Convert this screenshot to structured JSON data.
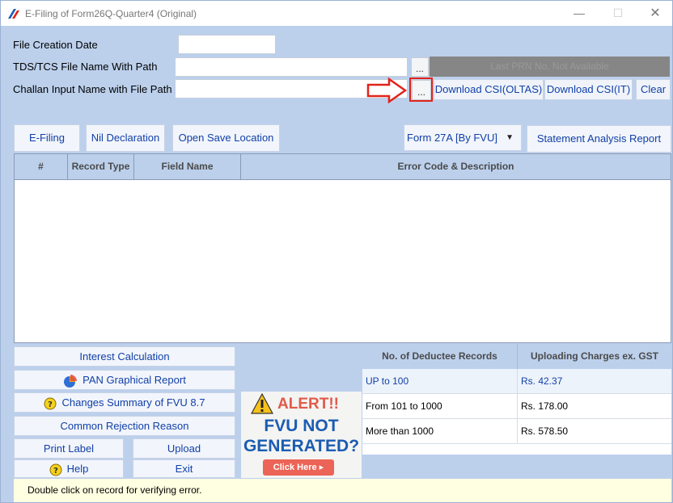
{
  "window": {
    "title": "E-Filing of Form26Q-Quarter4 (Original)",
    "minimize": "—",
    "maximize": "☐",
    "close": "✕"
  },
  "form": {
    "file_creation_date_label": "File Creation Date",
    "file_creation_date_value": "",
    "tds_file_label": "TDS/TCS File Name With Path",
    "tds_file_value": "",
    "tds_browse": "...",
    "prn_status": "Last PRN No. Not Available",
    "challan_label": "Challan Input Name with File Path",
    "challan_value": "",
    "challan_browse": "...",
    "download_oltas": "Download CSI(OLTAS)",
    "download_it": "Download CSI(IT)",
    "clear": "Clear"
  },
  "toolbar": {
    "efiling": "E-Filing",
    "nil_declaration": "Nil Declaration",
    "open_save_location": "Open Save Location",
    "form_select": "Form 27A [By FVU]",
    "statement_analysis": "Statement Analysis Report"
  },
  "grid": {
    "columns": [
      "#",
      "Record Type",
      "Field Name",
      "Error Code & Description"
    ],
    "rows": []
  },
  "panel": {
    "interest_calculation": "Interest Calculation",
    "pan_graphical_report": "PAN Graphical Report",
    "changes_summary": "Changes Summary of FVU 8.7",
    "common_rejection": "Common Rejection Reason",
    "print_label": "Print Label",
    "upload": "Upload",
    "help": "Help",
    "exit": "Exit"
  },
  "alert": {
    "title": "ALERT!!",
    "line1": "FVU NOT",
    "line2": "GENERATED?",
    "cta": "Click Here ▸"
  },
  "charges": {
    "headers": [
      "No. of Deductee Records",
      "Uploading Charges ex. GST"
    ],
    "rows": [
      {
        "range": "UP to 100",
        "charge": "Rs. 42.37"
      },
      {
        "range": "From 101 to 1000",
        "charge": "Rs. 178.00"
      },
      {
        "range": "More than 1000",
        "charge": "Rs. 578.50"
      }
    ]
  },
  "status": {
    "text": "Double click on record for verifying error."
  },
  "colors": {
    "window_bg": "#bcd0ec",
    "link_blue": "#1140a8",
    "highlight_red": "#e2231a",
    "alert_red": "#e05a4a",
    "fvu_blue": "#1b5cb3",
    "status_bg": "#ffffe1"
  }
}
